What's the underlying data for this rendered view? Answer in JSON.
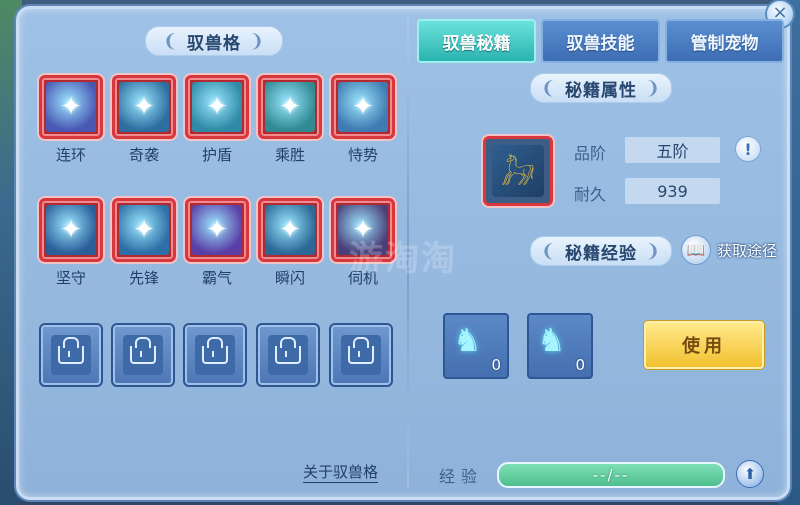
{
  "left_section": {
    "title": "驭兽格",
    "skills_row1": [
      {
        "label": "连环",
        "icon": "purple-flower-icon",
        "bg": "#4a58b4"
      },
      {
        "label": "奇袭",
        "icon": "slash-strike-icon",
        "bg": "#2d6ea0"
      },
      {
        "label": "护盾",
        "icon": "shield-icon",
        "bg": "#2e8aa6"
      },
      {
        "label": "乘胜",
        "icon": "wave-dash-icon",
        "bg": "#2f8a92"
      },
      {
        "label": "恃势",
        "icon": "claw-icon",
        "bg": "#3f7ab0"
      }
    ],
    "skills_row2": [
      {
        "label": "坚守",
        "icon": "guard-shield-icon",
        "bg": "#2b5f9a"
      },
      {
        "label": "先锋",
        "icon": "spearhead-icon",
        "bg": "#2d6fa6"
      },
      {
        "label": "霸气",
        "icon": "purple-flame-icon",
        "bg": "#5a3ea6"
      },
      {
        "label": "瞬闪",
        "icon": "blue-orb-icon",
        "bg": "#2c6996"
      },
      {
        "label": "伺机",
        "icon": "wolf-head-icon",
        "bg": "#4a3f7a"
      }
    ],
    "locked_slots": 5,
    "about_link": "关于驭兽格"
  },
  "tabs": [
    {
      "label": "驭兽秘籍",
      "active": true
    },
    {
      "label": "驭兽技能",
      "active": false
    },
    {
      "label": "管制宠物",
      "active": false
    }
  ],
  "book": {
    "attributes_title": "秘籍属性",
    "grade_label": "品阶",
    "grade_value": "五阶",
    "durability_label": "耐久",
    "durability_value": "939",
    "icon": "golden-beast-book-icon"
  },
  "experience": {
    "title": "秘籍经验",
    "obtain_label": "获取途径",
    "items": [
      {
        "icon": "horse-head-icon",
        "count": "0"
      },
      {
        "icon": "horse-head-icon",
        "count": "0"
      }
    ],
    "use_button": "使用",
    "exp_label": "经验",
    "exp_value": "--/--"
  },
  "watermark": "游淘淘",
  "colors": {
    "active_tab": "#2bb4b0",
    "inactive_tab": "#3d6db4",
    "skill_frame": "#d8373e",
    "use_button": "#f2c12f",
    "exp_bar": "#4fbf8f"
  }
}
